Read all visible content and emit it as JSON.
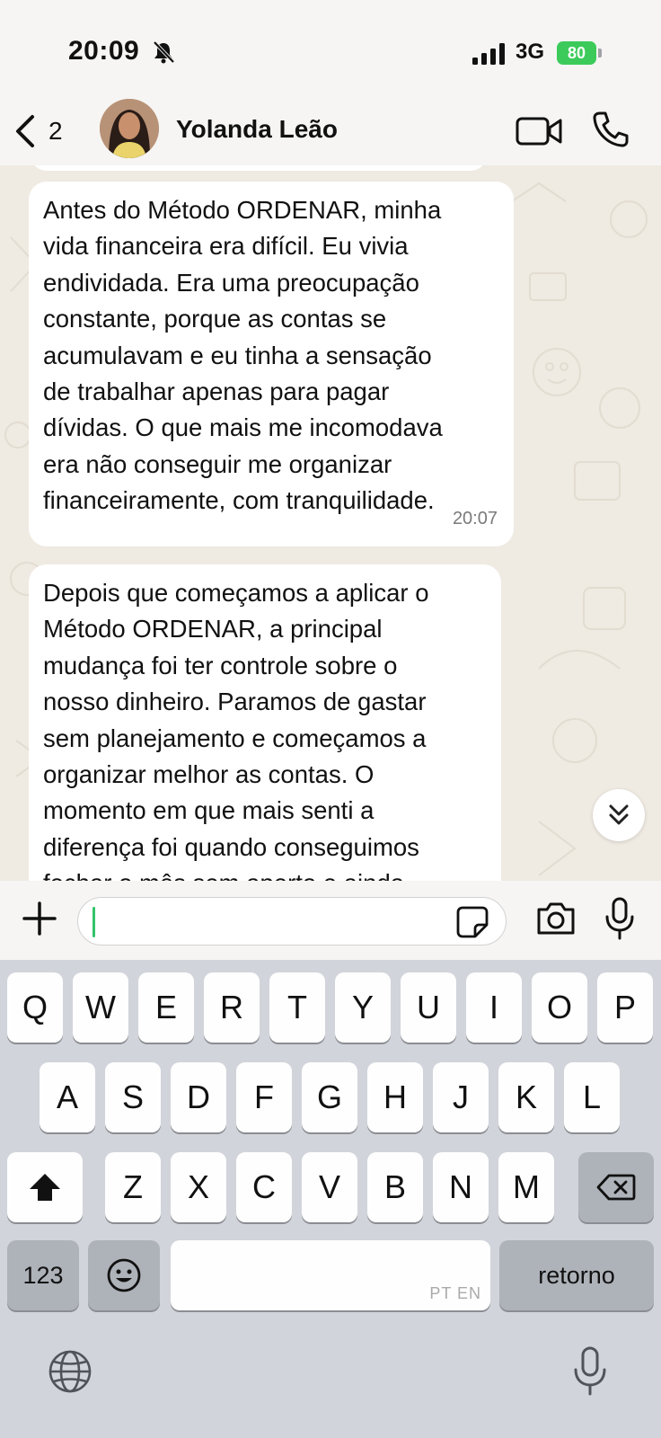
{
  "status_bar": {
    "time": "20:09",
    "network": "3G",
    "battery": "80"
  },
  "header": {
    "back_count": "2",
    "contact_name": "Yolanda Leão"
  },
  "messages": [
    {
      "text": "Antes do Método ORDENAR, minha\nvida financeira era difícil. Eu vivia\nendividada. Era uma preocupação\nconstante, porque as contas se\nacumulavam e eu tinha a sensação\nde trabalhar apenas para pagar\ndívidas. O que mais me incomodava\nera não conseguir me organizar\nfinanceiramente, com tranquilidade.",
      "time": "20:07"
    },
    {
      "text": "Depois que começamos a aplicar o\nMétodo ORDENAR, a principal\nmudança foi ter controle sobre o\nnosso dinheiro. Paramos de gastar\nsem planejamento e começamos a\norganizar melhor as contas. O\nmomento em que mais senti a\ndiferença foi quando conseguimos\nfechar o mês sem aperto e ainda",
      "time": ""
    }
  ],
  "input": {
    "placeholder": ""
  },
  "keyboard": {
    "row1": [
      "Q",
      "W",
      "E",
      "R",
      "T",
      "Y",
      "U",
      "I",
      "O",
      "P"
    ],
    "row2": [
      "A",
      "S",
      "D",
      "F",
      "G",
      "H",
      "J",
      "K",
      "L"
    ],
    "row3": [
      "Z",
      "X",
      "C",
      "V",
      "B",
      "N",
      "M"
    ],
    "numbers_key": "123",
    "return_key": "retorno",
    "space_hint": "PT EN"
  },
  "colors": {
    "chat_background": "#efeae2",
    "bubble": "#ffffff",
    "accent_green": "#33c46a",
    "battery_green": "#3ccb5a",
    "keyboard_bg": "#d1d4da"
  }
}
